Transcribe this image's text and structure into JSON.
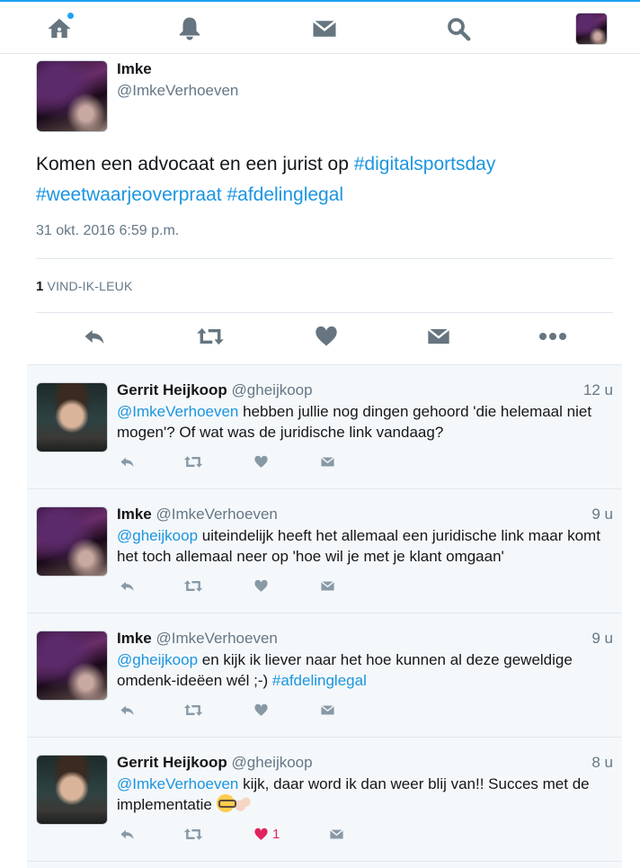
{
  "topbar": {
    "icons": [
      "home-icon",
      "bell-icon",
      "envelope-icon",
      "search-icon"
    ],
    "accent": "#1da1f2"
  },
  "main_tweet": {
    "name": "Imke",
    "handle": "@ImkeVerhoeven",
    "text_plain": "Komen een advocaat en een jurist op ",
    "hashtag1": "#digitalsportsday",
    "hashtag2": "#weetwaarjeoverpraat",
    "hashtag3": "#afdelinglegal",
    "date": "31 okt. 2016 6:59 p.m.",
    "likes_count": "1",
    "likes_label": "VIND-IK-LEUK"
  },
  "replies": [
    {
      "name": "Gerrit Heijkoop",
      "handle": "@gheijkoop",
      "time": "12 u",
      "mention": "@ImkeVerhoeven",
      "text": " hebben jullie nog dingen gehoord 'die helemaal niet mogen'? Of wat was de juridische link vandaag?"
    },
    {
      "name": "Imke",
      "handle": "@ImkeVerhoeven",
      "time": "9 u",
      "mention": "@gheijkoop",
      "text": " uiteindelijk heeft het allemaal een juridische link maar komt het toch allemaal neer op 'hoe wil je met je klant omgaan'"
    },
    {
      "name": "Imke",
      "handle": "@ImkeVerhoeven",
      "time": "9 u",
      "mention": "@gheijkoop",
      "text": " en kijk ik liever naar het hoe kunnen al deze geweldige omdenk-ideëen wél ;-) ",
      "hashtag": "#afdelinglegal"
    },
    {
      "name": "Gerrit Heijkoop",
      "handle": "@gheijkoop",
      "time": "8 u",
      "mention": "@ImkeVerhoeven",
      "text": " kijk, daar word ik dan weer blij van!! Succes met de implementatie ",
      "like_count": "1"
    }
  ],
  "colors": {
    "link": "#1b95e0",
    "like": "#e0245e",
    "muted": "#657786",
    "reply_bg": "#f5f8fa"
  }
}
